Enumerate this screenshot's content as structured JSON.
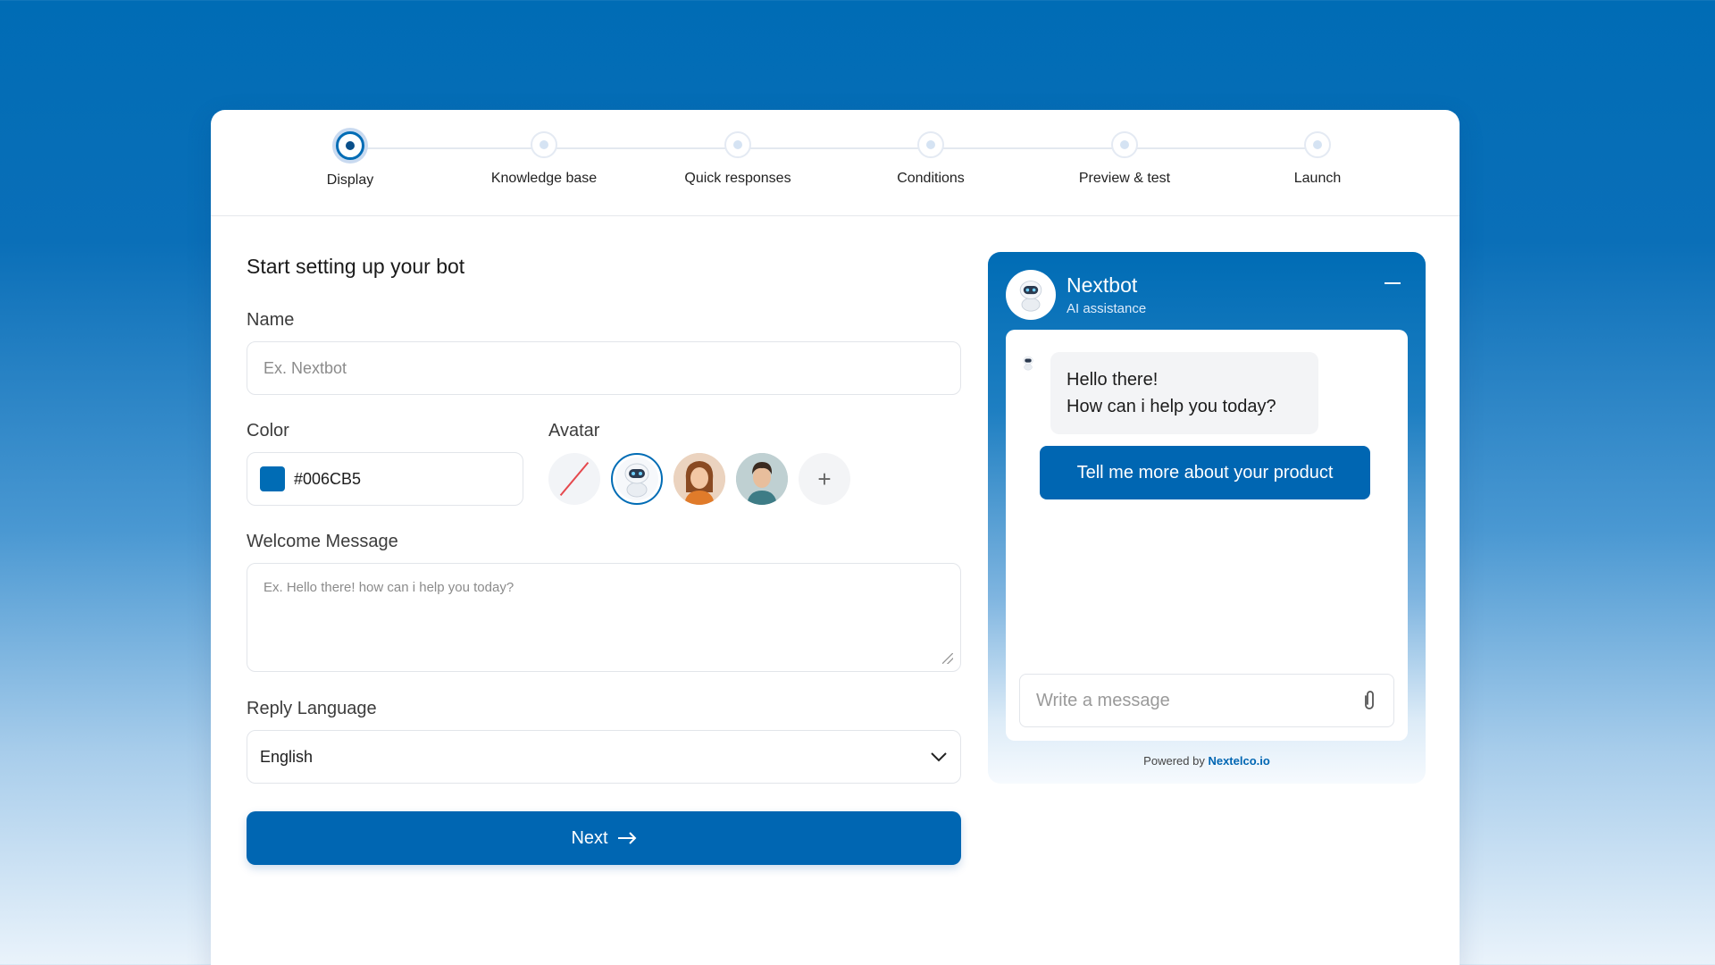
{
  "stepper": {
    "steps": [
      {
        "label": "Display",
        "active": true
      },
      {
        "label": "Knowledge base",
        "active": false
      },
      {
        "label": "Quick responses",
        "active": false
      },
      {
        "label": "Conditions",
        "active": false
      },
      {
        "label": "Preview & test",
        "active": false
      },
      {
        "label": "Launch",
        "active": false
      }
    ]
  },
  "form": {
    "title": "Start setting up your bot",
    "name": {
      "label": "Name",
      "placeholder": "Ex. Nextbot"
    },
    "color": {
      "label": "Color",
      "value": "#006CB5"
    },
    "avatar": {
      "label": "Avatar",
      "options": [
        "none",
        "robot",
        "woman",
        "man",
        "add"
      ],
      "selected": "robot"
    },
    "welcome": {
      "label": "Welcome Message",
      "placeholder": "Ex. Hello there! how can i help you today?"
    },
    "language": {
      "label": "Reply Language",
      "value": "English"
    },
    "next_label": "Next"
  },
  "chat": {
    "bot_name": "Nextbot",
    "bot_subtitle": "AI assistance",
    "bot_message_line1": "Hello there!",
    "bot_message_line2": "How can i help you today?",
    "user_message": "Tell me more about your product",
    "input_placeholder": "Write a message",
    "powered_prefix": "Powered by",
    "powered_brand": "Nextelco.io"
  },
  "colors": {
    "accent": "#006CB5",
    "button": "#0066B2"
  }
}
